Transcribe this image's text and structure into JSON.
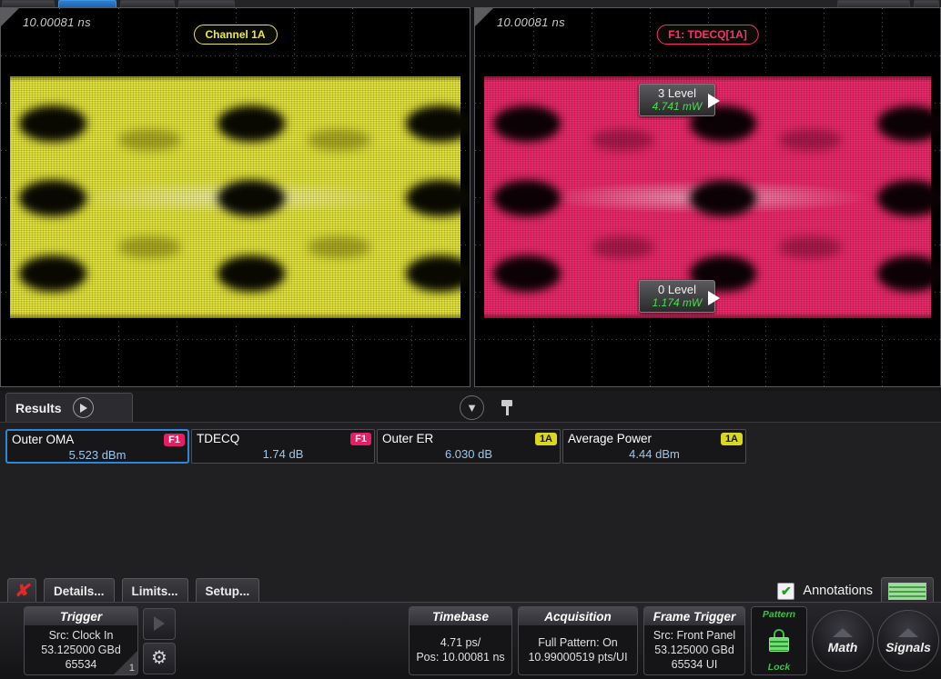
{
  "top_toolbar": {
    "buttons": [
      {
        "name": "toolbar-button-1",
        "selected": false
      },
      {
        "name": "toolbar-button-2",
        "selected": true
      },
      {
        "name": "toolbar-button-3",
        "selected": false
      },
      {
        "name": "toolbar-button-4",
        "selected": false
      }
    ]
  },
  "scopes": {
    "left": {
      "timestamp": "10.00081 ns",
      "channel_label": "Channel 1A",
      "trace_color": "#e8e84a",
      "signal_type": "PAM4 eye diagram"
    },
    "right": {
      "timestamp": "10.00081 ns",
      "function_label": "F1: TDECQ[1A]",
      "trace_color": "#e8306e",
      "signal_type": "PAM4 eye diagram",
      "annotations": [
        {
          "name": "3 Level",
          "value": "4.741 mW"
        },
        {
          "name": "0 Level",
          "value": "1.174 mW"
        }
      ]
    }
  },
  "results_panel": {
    "tab_label": "Results",
    "play_icon": "play-icon",
    "collapse_icon": "chevron-double-down-icon",
    "pin_icon": "pin-icon",
    "measurements": [
      {
        "name": "Outer OMA",
        "value": "5.523 dBm",
        "source": "F1",
        "source_color": "#e61e64",
        "selected": true
      },
      {
        "name": "TDECQ",
        "value": "1.74 dB",
        "source": "F1",
        "source_color": "#e61e64",
        "selected": false
      },
      {
        "name": "Outer ER",
        "value": "6.030 dB",
        "source": "1A",
        "source_color": "#d8d820",
        "selected": false
      },
      {
        "name": "Average Power",
        "value": "4.44 dBm",
        "source": "1A",
        "source_color": "#d8d820",
        "selected": false
      }
    ],
    "buttons": {
      "delete_label": "✘",
      "details_label": "Details...",
      "limits_label": "Limits...",
      "setup_label": "Setup..."
    },
    "annotations_toggle": {
      "label": "Annotations",
      "checked": true,
      "check_glyph": "✔",
      "swatch_name": "annotation-color-swatch"
    }
  },
  "status_bar": {
    "trigger": {
      "title": "Trigger",
      "lines": [
        "Src: Clock In",
        "53.125000 GBd",
        "65534"
      ],
      "corner_number": "1"
    },
    "side_buttons": {
      "run_icon": "play-icon",
      "settings_icon": "gear-icon",
      "gear_glyph": "⚙"
    },
    "timebase": {
      "title": "Timebase",
      "lines": [
        "4.71 ps/",
        "Pos: 10.00081 ns"
      ]
    },
    "acquisition": {
      "title": "Acquisition",
      "lines": [
        "Full Pattern: On",
        "10.99000519 pts/UI"
      ]
    },
    "frame_trigger": {
      "title": "Frame Trigger",
      "lines": [
        "Src: Front Panel",
        "53.125000 GBd",
        "65534 UI"
      ]
    },
    "pattern_lock": {
      "top_label": "Pattern",
      "bottom_label": "Lock",
      "icon": "padlock-locked-icon",
      "color": "#3fbf46"
    },
    "round_buttons": [
      {
        "label": "Math",
        "name": "math-button"
      },
      {
        "label": "Signals",
        "name": "signals-button"
      }
    ]
  }
}
